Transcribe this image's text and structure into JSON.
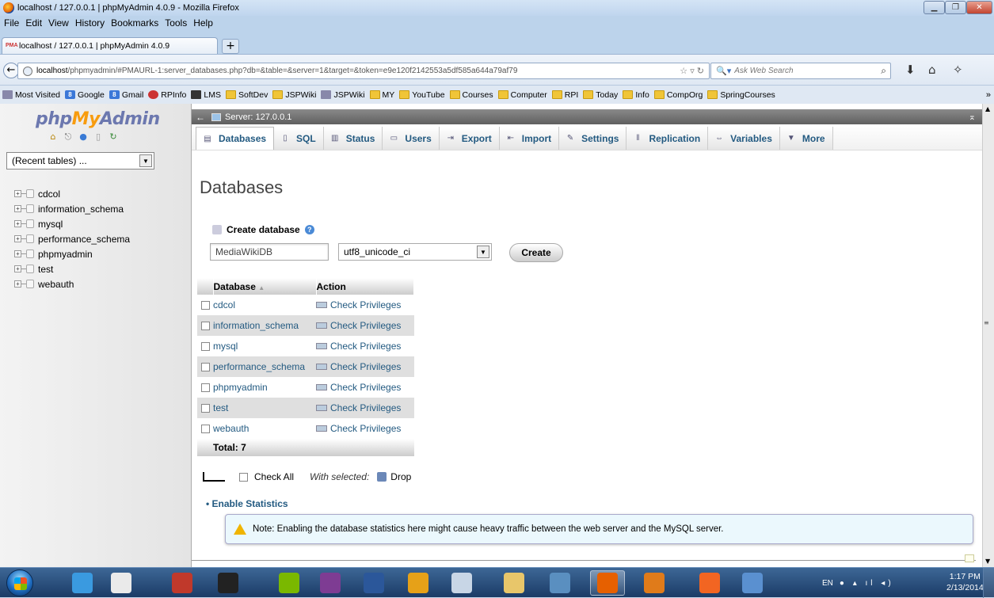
{
  "window": {
    "title": "localhost / 127.0.0.1 | phpMyAdmin 4.0.9 - Mozilla Firefox"
  },
  "menu": [
    "File",
    "Edit",
    "View",
    "History",
    "Bookmarks",
    "Tools",
    "Help"
  ],
  "tab": {
    "title": "localhost / 127.0.0.1 | phpMyAdmin 4.0.9",
    "icon_text": "PMA",
    "new_tab": "+"
  },
  "url": {
    "host": "localhost",
    "path": "/phpmyadmin/#PMAURL-1:server_databases.php?db=&table=&server=1&target=&token=e9e120f2142553a5df585a644a79af79"
  },
  "search": {
    "placeholder": "Ask Web Search"
  },
  "bookmarks": [
    {
      "label": "Most Visited",
      "icon": "most-visited-icon"
    },
    {
      "label": "Google",
      "icon": "google-icon"
    },
    {
      "label": "Gmail",
      "icon": "google-icon"
    },
    {
      "label": "RPInfo",
      "icon": "rpinfo-icon"
    },
    {
      "label": "LMS",
      "icon": "lms-icon"
    },
    {
      "label": "SoftDev",
      "icon": "folder-icon"
    },
    {
      "label": "JSPWiki",
      "icon": "folder-icon"
    },
    {
      "label": "JSPWiki",
      "icon": "jspwiki-icon"
    },
    {
      "label": "MY",
      "icon": "folder-icon"
    },
    {
      "label": "YouTube",
      "icon": "folder-icon"
    },
    {
      "label": "Courses",
      "icon": "folder-icon"
    },
    {
      "label": "Computer",
      "icon": "folder-icon"
    },
    {
      "label": "RPI",
      "icon": "folder-icon"
    },
    {
      "label": "Today",
      "icon": "folder-icon"
    },
    {
      "label": "Info",
      "icon": "folder-icon"
    },
    {
      "label": "CompOrg",
      "icon": "folder-icon"
    },
    {
      "label": "SpringCourses",
      "icon": "folder-icon"
    }
  ],
  "sidebar": {
    "logo_php": "php",
    "logo_my": "My",
    "logo_admin": "Admin",
    "recent_tables": "(Recent tables) ...",
    "databases": [
      "cdcol",
      "information_schema",
      "mysql",
      "performance_schema",
      "phpmyadmin",
      "test",
      "webauth"
    ]
  },
  "server_bar": {
    "label": "Server: 127.0.0.1"
  },
  "tabs": [
    {
      "label": "Databases",
      "icon": "database-icon",
      "active": true
    },
    {
      "label": "SQL",
      "icon": "sql-icon"
    },
    {
      "label": "Status",
      "icon": "status-icon"
    },
    {
      "label": "Users",
      "icon": "users-icon"
    },
    {
      "label": "Export",
      "icon": "export-icon"
    },
    {
      "label": "Import",
      "icon": "import-icon"
    },
    {
      "label": "Settings",
      "icon": "wrench-icon"
    },
    {
      "label": "Replication",
      "icon": "replication-icon"
    },
    {
      "label": "Variables",
      "icon": "variables-icon"
    },
    {
      "label": "More",
      "icon": "triangle-down-icon"
    }
  ],
  "page": {
    "heading": "Databases",
    "create_label": "Create database",
    "db_name_value": "MediaWikiDB",
    "collation_value": "utf8_unicode_ci",
    "create_button": "Create"
  },
  "table": {
    "headers": {
      "database": "Database",
      "action": "Action"
    },
    "sort_indicator": "▲",
    "rows": [
      {
        "name": "cdcol",
        "action": "Check Privileges"
      },
      {
        "name": "information_schema",
        "action": "Check Privileges"
      },
      {
        "name": "mysql",
        "action": "Check Privileges"
      },
      {
        "name": "performance_schema",
        "action": "Check Privileges"
      },
      {
        "name": "phpmyadmin",
        "action": "Check Privileges"
      },
      {
        "name": "test",
        "action": "Check Privileges"
      },
      {
        "name": "webauth",
        "action": "Check Privileges"
      }
    ],
    "total": "Total: 7"
  },
  "bulk": {
    "check_all": "Check All",
    "with_selected": "With selected:",
    "drop": "Drop"
  },
  "stats": {
    "enable": "Enable Statistics",
    "note": "Note: Enabling the database statistics here might cause heavy traffic between the web server and the MySQL server."
  },
  "taskbar": {
    "apps": [
      "ie-icon",
      "clock-icon",
      "pin-icon",
      "cmd-icon",
      "notepad-icon",
      "onenote-icon",
      "word-icon",
      "outlook-icon",
      "snipping-icon",
      "explorer-icon",
      "virtualbox-icon",
      "firefox-icon",
      "media-icon",
      "xampp-icon",
      "network-icon"
    ],
    "language": "EN",
    "time": "1:17 PM",
    "date": "2/13/2014"
  }
}
